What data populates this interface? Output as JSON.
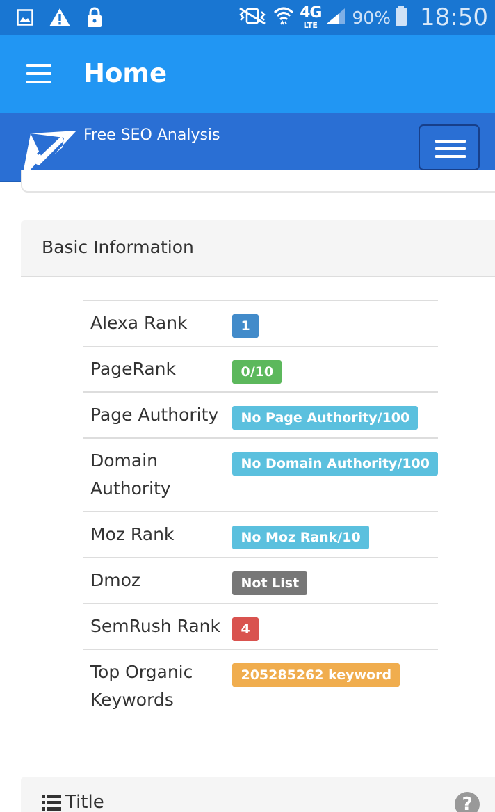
{
  "status_bar": {
    "icons_left": [
      "image-icon",
      "warning-icon",
      "lock-icon"
    ],
    "icons_right": [
      "vibrate-icon",
      "wifi-icon",
      "signal-icon",
      "battery-icon"
    ],
    "network": "4G",
    "network_sub": "LTE",
    "battery": "90%",
    "time": "18:50"
  },
  "app_bar": {
    "title": "Home",
    "menu_icon": "hamburger-menu-icon"
  },
  "site_nav": {
    "brand": "Free SEO Analysis",
    "toggle_icon": "hamburger-menu-icon"
  },
  "basic_info": {
    "heading": "Basic Information",
    "rows": [
      {
        "label": "Alexa Rank",
        "value": "1",
        "color": "#428bca"
      },
      {
        "label": "PageRank",
        "value": "0/10",
        "color": "#5cb85c"
      },
      {
        "label": "Page Authority",
        "value": "No Page Authority/100",
        "color": "#5bc0de"
      },
      {
        "label": "Domain Authority",
        "value": "No Domain Authority/100",
        "color": "#5bc0de"
      },
      {
        "label": "Moz Rank",
        "value": "No Moz Rank/10",
        "color": "#5bc0de"
      },
      {
        "label": "Dmoz",
        "value": "Not List",
        "color": "#777777"
      },
      {
        "label": "SemRush Rank",
        "value": "4",
        "color": "#d9534f"
      },
      {
        "label": "Top Organic Keywords",
        "value": "205285262 keyword",
        "color": "#f0ad4e"
      }
    ]
  },
  "title_panel": {
    "heading": "Title",
    "help_symbol": "?"
  }
}
